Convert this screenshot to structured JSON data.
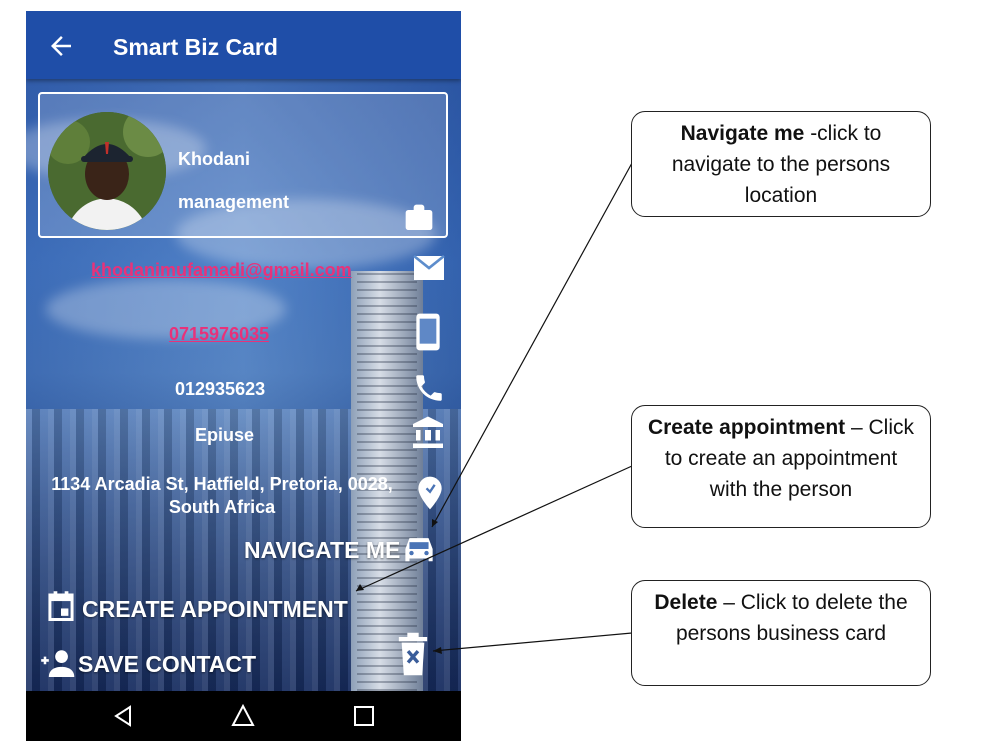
{
  "app": {
    "title": "Smart Biz Card"
  },
  "contact": {
    "name": "Khodani",
    "role": "management",
    "email": "khodanimufamadi@gmail.com",
    "mobile": "0715976035",
    "phone": "012935623",
    "company": "Epiuse",
    "address": "1134 Arcadia St, Hatfield, Pretoria, 0028, South Africa"
  },
  "actions": {
    "navigate": "NAVIGATE ME",
    "appointment": "CREATE APPOINTMENT",
    "save": "SAVE CONTACT"
  },
  "callouts": {
    "navigate": {
      "bold": "Navigate me",
      "text": " -click to navigate to the persons location"
    },
    "appointment": {
      "bold": "Create appointment",
      "text": " – Click to create an appointment with the person"
    },
    "delete": {
      "bold": "Delete",
      "text": " – Click to delete the persons business card"
    }
  },
  "colors": {
    "appbar": "#1f4ea8",
    "link": "#e8327a",
    "background": "#ffffff"
  }
}
